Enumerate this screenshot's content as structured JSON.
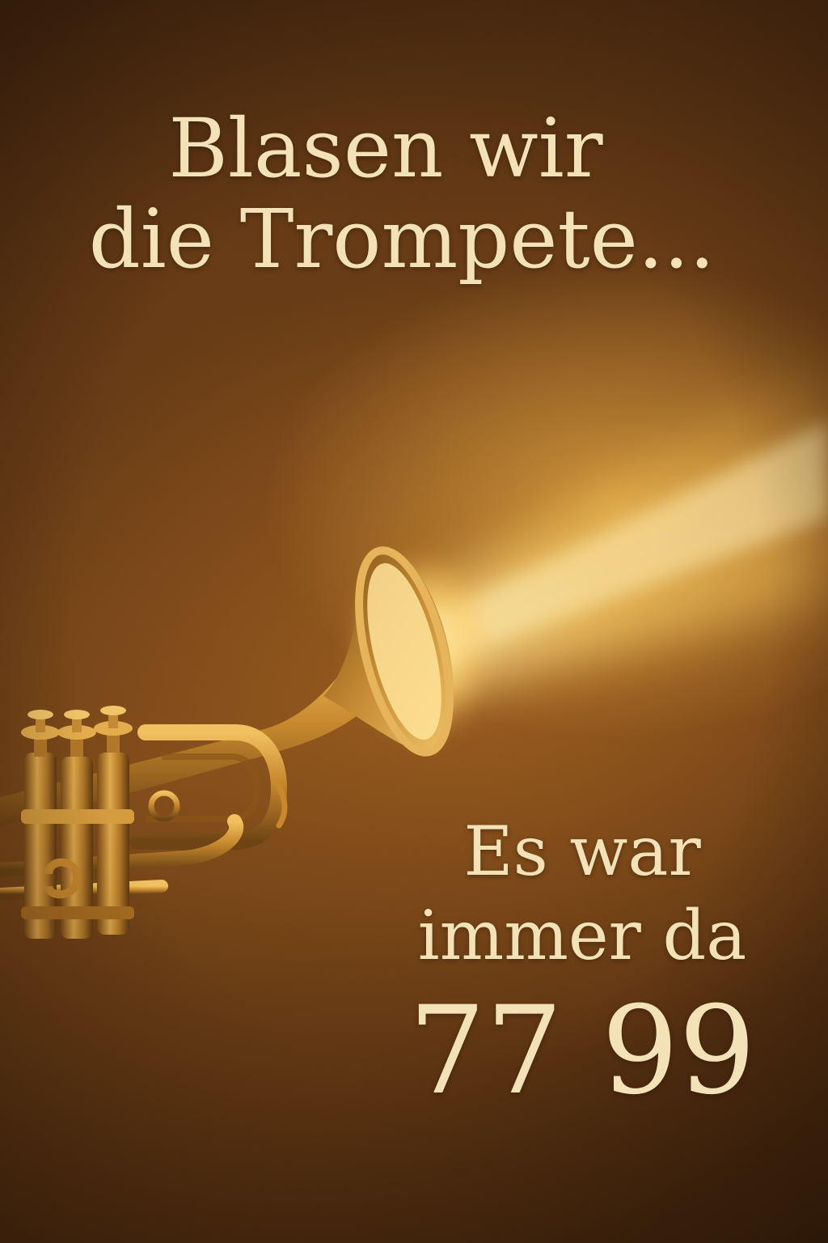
{
  "headline": {
    "line1": "Blasen wir",
    "line2": "die Trompete..."
  },
  "footer": {
    "line1": "Es war",
    "line2": "immer da",
    "number": "77 99"
  },
  "colors": {
    "text": "#f3e2b8",
    "background": "#6d3f17",
    "glow": "#ffd27a",
    "brass": "#c8892e"
  },
  "icons": {
    "illustration": "trumpet-icon"
  }
}
